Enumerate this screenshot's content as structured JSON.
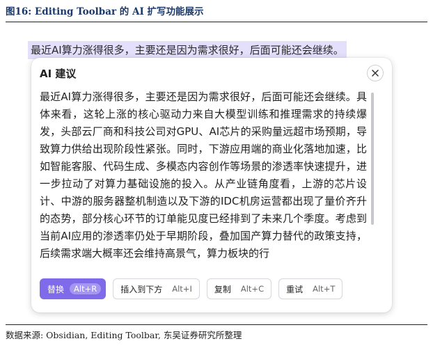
{
  "figure": {
    "title": "图16:  Editing Toolbar 的 AI 扩写功能展示",
    "source": "数据来源:  Obsidian,  Editing Toolbar,  东吴证券研究所整理"
  },
  "editor": {
    "selected_text": "最近AI算力涨得很多，主要还是因为需求很好，后面可能还会继续。"
  },
  "ai_panel": {
    "title": "AI 建议",
    "close_icon": "close-icon",
    "body_text": "最近AI算力涨得很多，主要还是因为需求很好，后面可能还会继续。具体来看，这轮上涨的核心驱动力来自大模型训练和推理需求的持续爆发，头部云厂商和科技公司对GPU、AI芯片的采购量远超市场预期，导致算力供给出现阶段性紧张。同时，下游应用端的商业化落地加速，比如智能客服、代码生成、多模态内容创作等场景的渗透率快速提升，进一步拉动了对算力基础设施的投入。从产业链角度看，上游的芯片设计、中游的服务器整机制造以及下游的IDC机房运营都出现了量价齐升的态势，部分核心环节的订单能见度已经排到了未来几个季度。考虑到当前AI应用的渗透率仍处于早期阶段，叠加国产算力替代的政策支持，后续需求端大概率还会维持高景气，算力板块的行",
    "actions": {
      "replace": {
        "label": "替换",
        "shortcut": "Alt+R"
      },
      "insert_below": {
        "label": "插入到下方",
        "shortcut": "Alt+I"
      },
      "copy": {
        "label": "复制",
        "shortcut": "Alt+C"
      },
      "retry": {
        "label": "重试",
        "shortcut": "Alt+T"
      }
    }
  },
  "colors": {
    "accent": "#7f6bea",
    "selection": "#e4e0fb",
    "title_blue": "#1b3a6b"
  }
}
